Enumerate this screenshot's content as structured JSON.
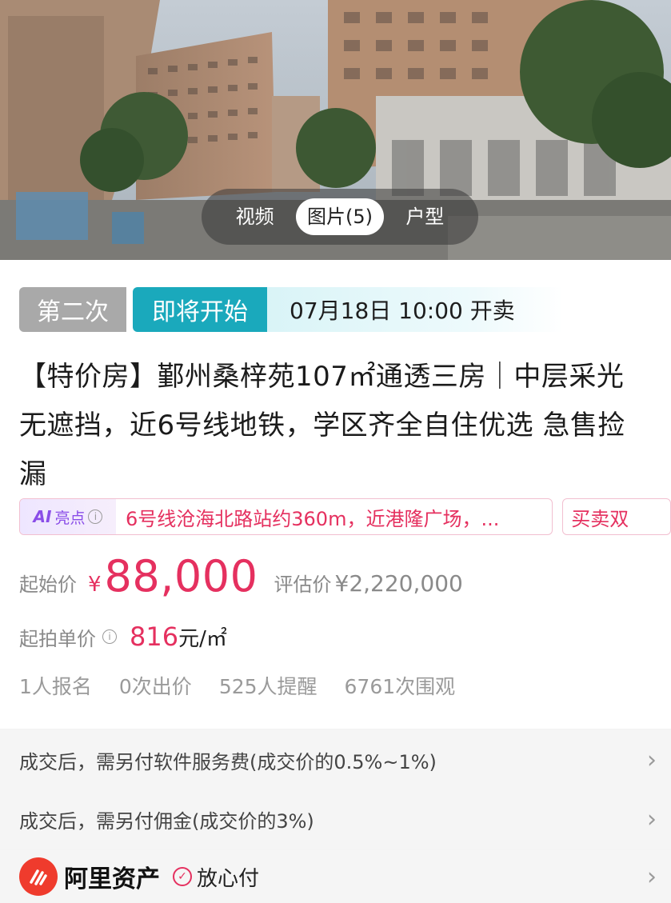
{
  "media": {
    "tabs": [
      {
        "label": "视频",
        "active": false
      },
      {
        "label": "图片(5)",
        "active": true
      },
      {
        "label": "户型",
        "active": false
      }
    ]
  },
  "status": {
    "round": "第二次",
    "state": "即将开始",
    "start_time": "07月18日 10:00 开卖"
  },
  "listing": {
    "title": "【特价房】鄞州桑梓苑107㎡通透三房｜中层采光无遮挡，近6号线地铁，学区齐全自住优选 急售捡漏"
  },
  "ai_highlights": {
    "badge_ai": "AI",
    "badge_label": "亮点",
    "text": "6号线沧海北路站约360m，近港隆广场，...",
    "second": "买卖双"
  },
  "price": {
    "start_label": "起始价",
    "currency": "¥",
    "start_value": "88,000",
    "eval_label": "评估价",
    "eval_value": "¥2,220,000",
    "unit_label": "起拍单价",
    "unit_value": "816",
    "unit_suffix": "元/㎡"
  },
  "stats": [
    "1人报名",
    "0次出价",
    "525人提醒",
    "6761次围观"
  ],
  "fees": [
    {
      "text": "成交后，需另付软件服务费(成交价的0.5%~1%)"
    },
    {
      "text": "成交后，需另付佣金(成交价的3%)"
    }
  ],
  "footer": {
    "brand": "阿里资产",
    "safe_pay": "放心付"
  },
  "colors": {
    "accent_red": "#e5305f",
    "teal": "#1aa9bc",
    "grey_tag": "#a9a9a9",
    "ai_purple": "#8a4de8",
    "brand_red": "#ef3b2d"
  }
}
